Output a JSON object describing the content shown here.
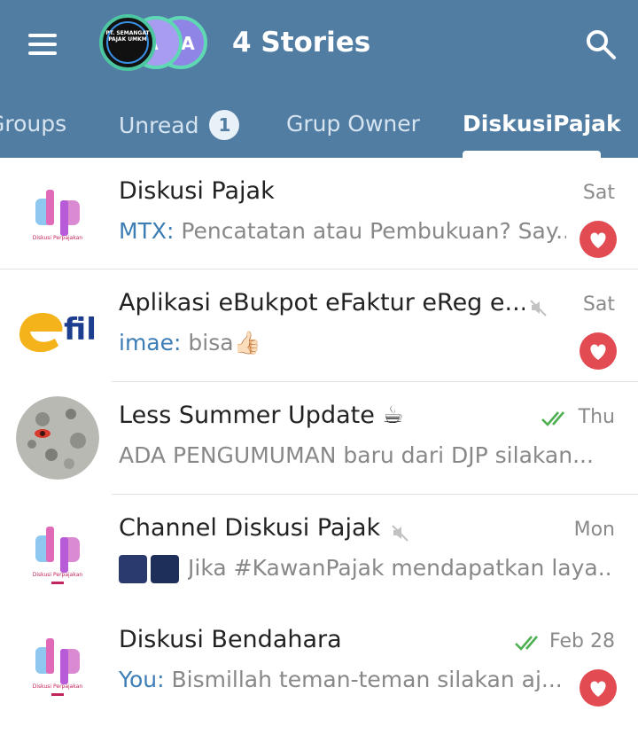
{
  "header": {
    "title": "4 Stories",
    "stories": [
      {
        "logo_text": "PT. SEMANGAT PAJAK UMKM"
      },
      {
        "letter": "A"
      },
      {
        "letter": "A"
      }
    ],
    "colors": {
      "background": "#527da3",
      "story_ring": "#5fd9b3"
    }
  },
  "tabs": [
    {
      "label": "Groups"
    },
    {
      "label": "Unread",
      "badge": "1"
    },
    {
      "label": "Grup Owner"
    },
    {
      "label": "DiskusiPajak",
      "active": true
    }
  ],
  "chats": [
    {
      "name": "Diskusi Pajak",
      "time": "Sat",
      "sender": "MTX: ",
      "preview": "Pencatatan atau Pembukuan? Say...",
      "reaction": "heart",
      "avatar_caption": "Diskusi Perpajakan"
    },
    {
      "name": "Aplikasi eBukpot eFaktur eReg e...",
      "time": "Sat",
      "muted": true,
      "sender": "imae: ",
      "preview": "bisa👍🏻",
      "reaction": "heart",
      "avatar_text": "fil"
    },
    {
      "name": "Less Summer Update ☕",
      "time": "Thu",
      "read": true,
      "sender": "",
      "preview": "ADA PENGUMUMAN baru dari DJP  silakan..."
    },
    {
      "name": "Channel Diskusi Pajak",
      "time": "Mon",
      "muted": true,
      "sender": "",
      "preview": "Jika #KawanPajak mendapatkan laya...",
      "avatar_caption": "Diskusi Perpajakan"
    },
    {
      "name": "Diskusi Bendahara",
      "time": "Feb 28",
      "read": true,
      "sender": "You: ",
      "preview": "Bismillah teman-teman silakan aj...",
      "reaction": "heart",
      "avatar_caption": "Diskusi Perpajakan"
    }
  ]
}
